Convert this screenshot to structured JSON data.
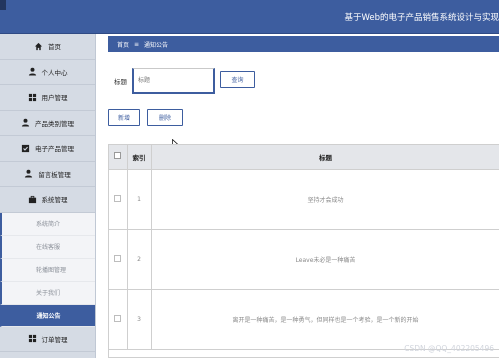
{
  "header": {
    "app_title": "基于Web的电子产品销售系统设计与实现"
  },
  "sidebar": {
    "items": [
      {
        "label": "首页",
        "icon": "home-icon"
      },
      {
        "label": "个人中心",
        "icon": "user-icon"
      },
      {
        "label": "用户管理",
        "icon": "grid-icon"
      },
      {
        "label": "产品类别管理",
        "icon": "user-icon"
      },
      {
        "label": "电子产品管理",
        "icon": "checkbox-icon"
      },
      {
        "label": "留言板管理",
        "icon": "user-icon"
      },
      {
        "label": "系统管理",
        "icon": "briefcase-icon"
      }
    ],
    "sub_items": [
      {
        "label": "系统简介"
      },
      {
        "label": "在线客服"
      },
      {
        "label": "轮播图管理"
      },
      {
        "label": "关于我们"
      },
      {
        "label": "通知公告"
      }
    ],
    "bottom_item": {
      "label": "订单管理",
      "icon": "grid-icon"
    }
  },
  "breadcrumb": {
    "home": "首页",
    "separator": "≡",
    "current": "通知公告"
  },
  "filter": {
    "label": "标题",
    "placeholder": "标题",
    "query_button": "查询"
  },
  "actions": {
    "add_button": "新增",
    "delete_button": "删除"
  },
  "table": {
    "columns": [
      "索引",
      "标题"
    ],
    "rows": [
      {
        "index": "1",
        "title": "坚持才会成功"
      },
      {
        "index": "2",
        "title": "Leave未必是一种痛苦"
      },
      {
        "index": "3",
        "title": "离开是一种痛苦，是一种勇气，但同样也是一个考验，是一个新的开始"
      }
    ]
  },
  "watermark": "CSDN @QQ_402205496",
  "colors": {
    "primary": "#3d5d9f",
    "sidebar_bg": "#d5dbe4",
    "table_header_bg": "#e4e6ea"
  }
}
